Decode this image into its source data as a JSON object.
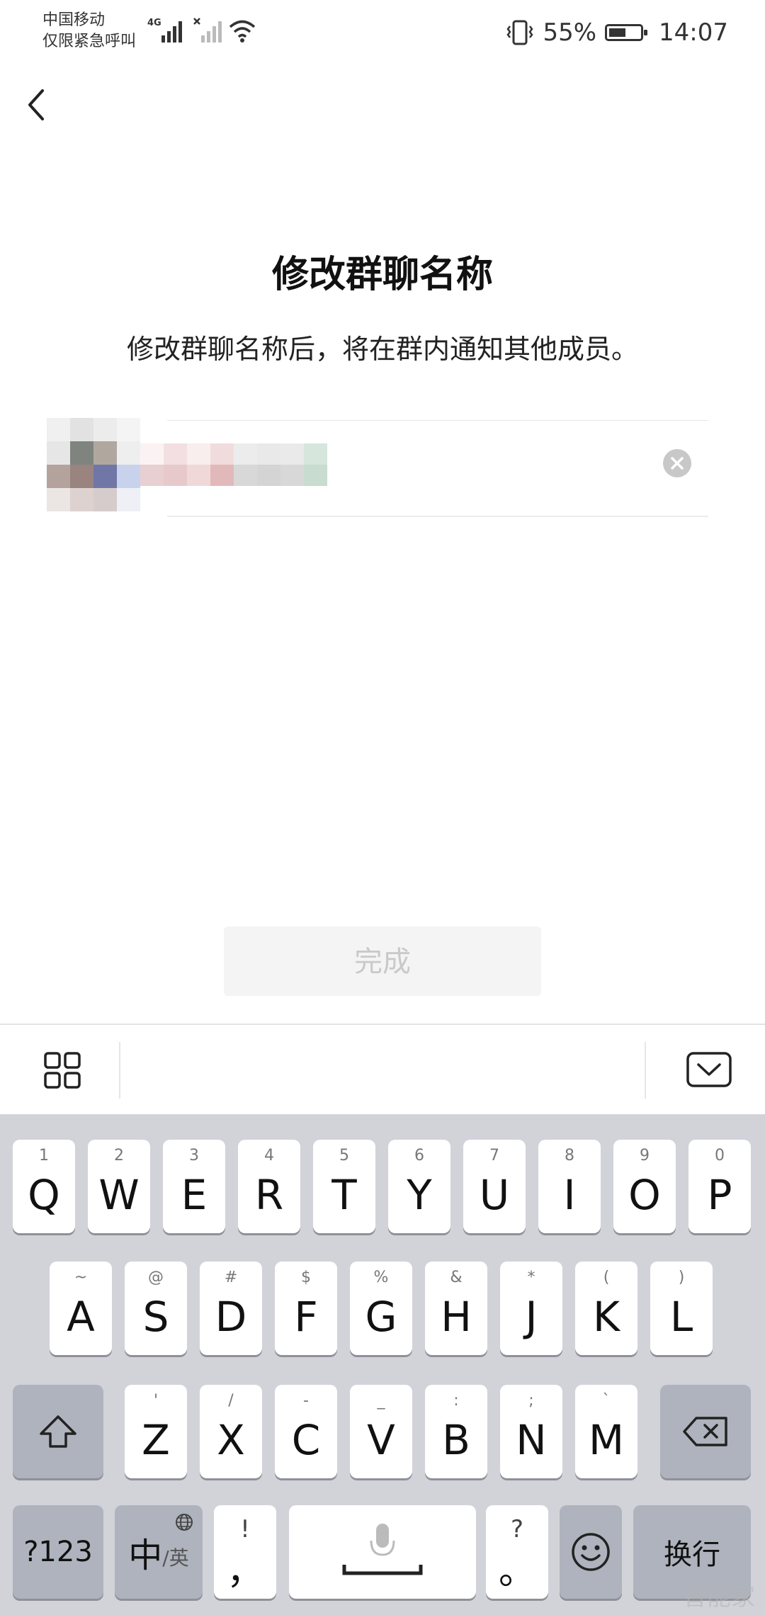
{
  "status_bar": {
    "carrier": "中国移动",
    "carrier_sub": "仅限紧急呼叫",
    "network": "4G",
    "battery": "55%",
    "battery_level": 0.55,
    "time": "14:07"
  },
  "page": {
    "title": "修改群聊名称",
    "subtitle": "修改群聊名称后，将在群内通知其他成员。",
    "done_label": "完成"
  },
  "keyboard": {
    "row1": [
      {
        "key": "Q",
        "hint": "1"
      },
      {
        "key": "W",
        "hint": "2"
      },
      {
        "key": "E",
        "hint": "3"
      },
      {
        "key": "R",
        "hint": "4"
      },
      {
        "key": "T",
        "hint": "5"
      },
      {
        "key": "Y",
        "hint": "6"
      },
      {
        "key": "U",
        "hint": "7"
      },
      {
        "key": "I",
        "hint": "8"
      },
      {
        "key": "O",
        "hint": "9"
      },
      {
        "key": "P",
        "hint": "0"
      }
    ],
    "row2": [
      {
        "key": "A",
        "hint": "~"
      },
      {
        "key": "S",
        "hint": "@"
      },
      {
        "key": "D",
        "hint": "#"
      },
      {
        "key": "F",
        "hint": "$"
      },
      {
        "key": "G",
        "hint": "%"
      },
      {
        "key": "H",
        "hint": "&"
      },
      {
        "key": "J",
        "hint": "*"
      },
      {
        "key": "K",
        "hint": "("
      },
      {
        "key": "L",
        "hint": ")"
      }
    ],
    "row3": [
      {
        "key": "Z",
        "hint": "'"
      },
      {
        "key": "X",
        "hint": "/"
      },
      {
        "key": "C",
        "hint": "-"
      },
      {
        "key": "V",
        "hint": "_"
      },
      {
        "key": "B",
        "hint": ":"
      },
      {
        "key": "N",
        "hint": ";"
      },
      {
        "key": "M",
        "hint": "`"
      }
    ],
    "num_key": "?123",
    "lang_main": "中",
    "lang_sub": "/英",
    "comma_hint": "!",
    "comma": "，",
    "period_hint": "?",
    "period": "。",
    "enter_label": "换行"
  },
  "icons": {
    "back": "chevron-left-icon",
    "clear": "clear-icon",
    "grid": "grid-icon",
    "hide_keyboard": "keyboard-hide-icon",
    "shift": "shift-icon",
    "delete": "backspace-icon",
    "mic": "microphone-icon",
    "globe": "globe-icon",
    "emoji": "emoji-icon"
  },
  "watermark": "智能家"
}
